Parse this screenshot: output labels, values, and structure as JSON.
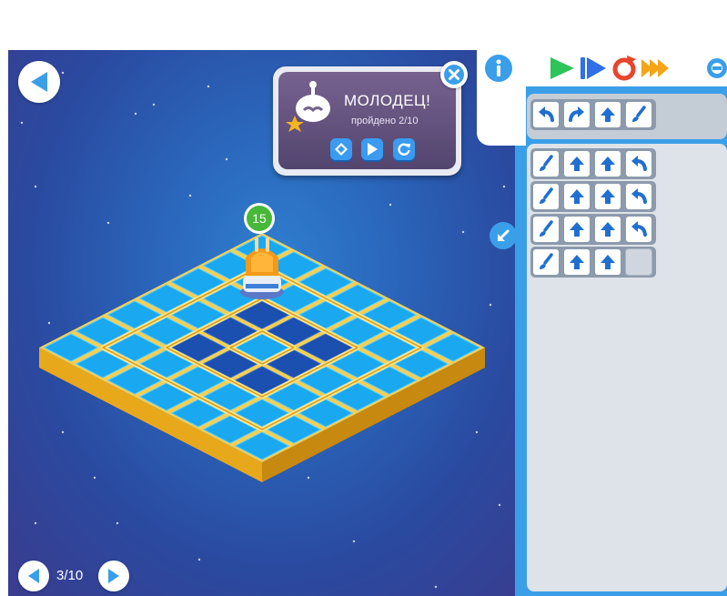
{
  "popup": {
    "title": "МОЛОДЕЦ!",
    "subtitle": "пройдено 2/10",
    "buttons": [
      "map-icon",
      "play-icon",
      "restart-icon"
    ]
  },
  "counter": {
    "value": "15"
  },
  "pager": {
    "label": "3/10"
  },
  "toolbar": {
    "info_icon": "info-icon",
    "run_icon": "play-icon",
    "step_icon": "step-icon",
    "reset_icon": "reset-icon",
    "fast_icon": "fast-forward-icon",
    "settings_icon": "gear-icon"
  },
  "procedure": [
    "turn-left",
    "turn-right",
    "forward",
    "paint"
  ],
  "program": [
    [
      "paint",
      "forward",
      "forward",
      "turn-left"
    ],
    [
      "paint",
      "forward",
      "forward",
      "turn-left"
    ],
    [
      "paint",
      "forward",
      "forward",
      "turn-left"
    ],
    [
      "paint",
      "forward",
      "forward",
      "empty"
    ]
  ],
  "colors": {
    "accent": "#3a9fe8",
    "panel_bg": "#dee3ea",
    "tile_cyan": "#1aa8f0",
    "tile_dark": "#1b4fb0",
    "border_yellow": "#f0c43a",
    "counter_green": "#46b83a",
    "play_green": "#2ec45a",
    "reset_red": "#e8452c",
    "fast_orange": "#f4a416"
  }
}
